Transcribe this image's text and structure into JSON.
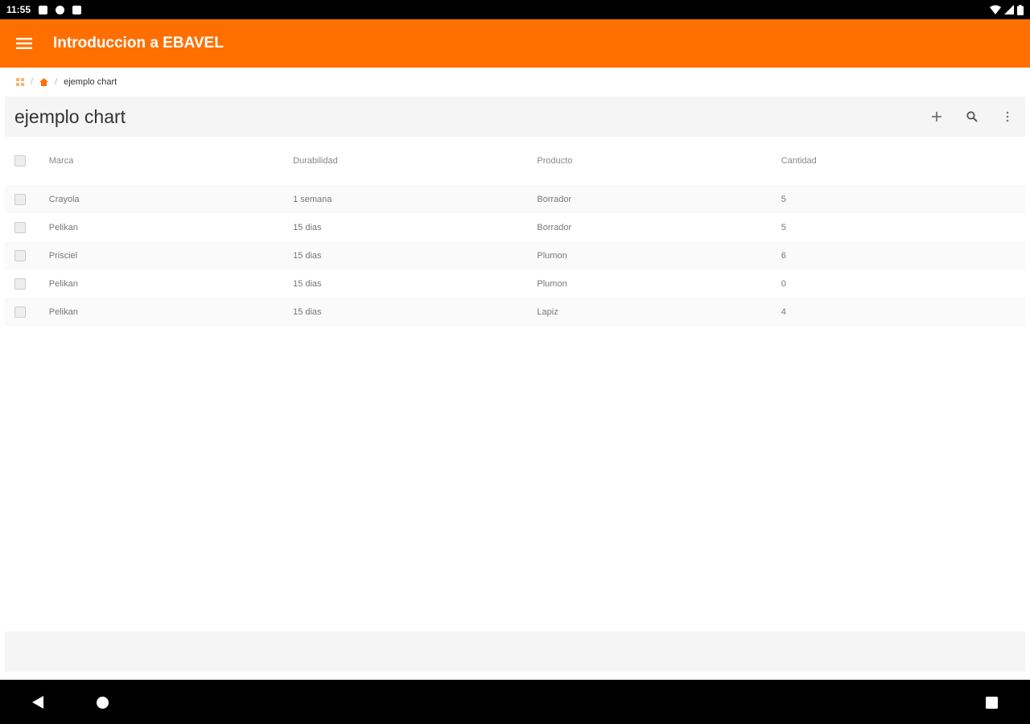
{
  "status_bar": {
    "time": "11:55"
  },
  "app_bar": {
    "title": "Introduccion a EBAVEL",
    "menu_icon": "hamburger-menu-icon"
  },
  "breadcrumb": {
    "current": "ejemplo chart"
  },
  "page": {
    "title": "ejemplo chart",
    "actions": [
      "add-icon",
      "search-icon",
      "more-vert-icon"
    ]
  },
  "table": {
    "columns": [
      "Marca",
      "Durabilidad",
      "Producto",
      "Cantidad"
    ],
    "rows": [
      [
        "Crayola",
        "1 semana",
        "Borrador",
        "5"
      ],
      [
        "Pelikan",
        "15 dias",
        "Borrador",
        "5"
      ],
      [
        "Prisciel",
        "15 dias",
        "Plumon",
        "6"
      ],
      [
        "Pelikan",
        "15 dias",
        "Plumon",
        "0"
      ],
      [
        "Pelikan",
        "15 dias",
        "Lapiz",
        "4"
      ]
    ]
  },
  "colors": {
    "accent": "#ff6f00",
    "panel": "#f5f5f5"
  }
}
